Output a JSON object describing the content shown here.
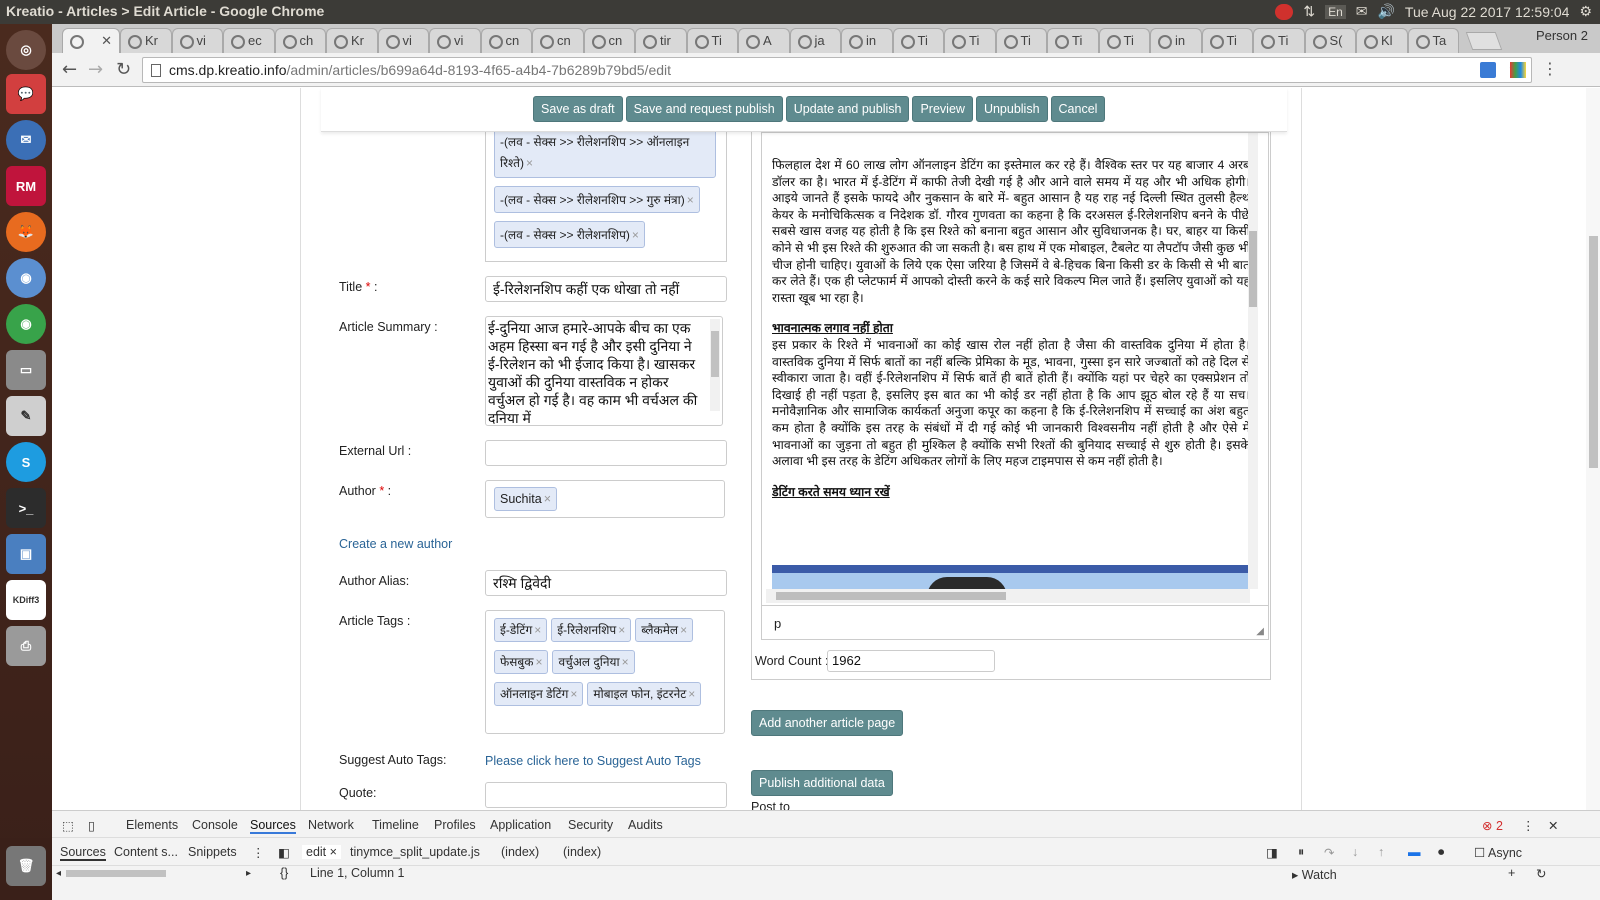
{
  "os": {
    "window_title": "Kreatio - Articles > Edit Article - Google Chrome",
    "language": "En",
    "clock": "Tue Aug 22 2017 12:59:04"
  },
  "launcher": {
    "items": [
      "ubuntu-logo-icon",
      "chat-icon",
      "thunderbird-icon",
      "rubymine-icon",
      "firefox-icon",
      "chromium-icon",
      "chrome-icon",
      "files-icon",
      "text-editor-icon",
      "skype-icon",
      "terminal-icon",
      "virtualbox-icon",
      "kdiff3-icon",
      "printer-icon",
      "trash-icon"
    ],
    "rubymine_label": "RM",
    "kdiff_label": "KDiff3"
  },
  "tabs": [
    {
      "label": "",
      "active": true
    },
    {
      "label": "Kr"
    },
    {
      "label": "vi"
    },
    {
      "label": "ec"
    },
    {
      "label": "ch"
    },
    {
      "label": "Kr"
    },
    {
      "label": "vi"
    },
    {
      "label": "vi"
    },
    {
      "label": "cn"
    },
    {
      "label": "cn"
    },
    {
      "label": "cn"
    },
    {
      "label": "tir"
    },
    {
      "label": "Ti"
    },
    {
      "label": "A"
    },
    {
      "label": "ja"
    },
    {
      "label": "in"
    },
    {
      "label": "Ti"
    },
    {
      "label": "Ti"
    },
    {
      "label": "Ti"
    },
    {
      "label": "Ti"
    },
    {
      "label": "Ti"
    },
    {
      "label": "in"
    },
    {
      "label": "Ti"
    },
    {
      "label": "Ti"
    },
    {
      "label": "S("
    },
    {
      "label": "Kl"
    },
    {
      "label": "Ta"
    }
  ],
  "profile": "Person 2",
  "url": {
    "domain": "cms.dp.kreatio.info",
    "path": "/admin/articles/b699a64d-8193-4f65-a4b4-7b6289b79bd5/edit"
  },
  "actions": [
    "Save as draft",
    "Save and request publish",
    "Update and publish",
    "Preview",
    "Unpublish",
    "Cancel"
  ],
  "sections_box": {
    "chips": [
      "-(लव - सेक्स >> रीलेशनशिप >> ऑनलाइन रिश्ते)",
      "-(लव - सेक्स >> रीलेशनशिप >> गुरु मंत्रा)",
      "-(लव - सेक्स >> रीलेशनशिप)"
    ]
  },
  "form": {
    "title_label": "Title",
    "title_value": "ई-रिलेशनशिप कहीं एक धोखा तो नहीं",
    "summary_label": "Article Summary :",
    "summary_value": "ई-दुनिया आज हमारे-आपके बीच का एक अहम हिस्सा बन गई है और इसी दुनिया ने ई-रिलेशन को भी ईजाद किया है। खासकर युवाओं की दुनिया वास्तविक न होकर वर्चुअल हो गई है। वह काम भी वर्चअल की दनिया में",
    "external_url_label": "External Url :",
    "external_url_value": "",
    "author_label": "Author",
    "author_chip": "Suchita",
    "create_author_link": "Create a new author",
    "author_alias_label": "Author Alias:",
    "author_alias_value": "रश्मि द्विवेदी",
    "tags_label": "Article Tags :",
    "tags": [
      "ई-डेटिंग",
      "ई-रिलेशनशिप",
      "ब्लैकमेल",
      "फेसबुक",
      "वर्चुअल दुनिया",
      "ऑनलाइन डेटिंग",
      "मोबाइल फोन, इंटरनेट"
    ],
    "suggest_label": "Suggest Auto Tags:",
    "suggest_link": "Please click here to Suggest Auto Tags",
    "quote_label": "Quote:",
    "quote_value": ""
  },
  "editor": {
    "para1": "फिलहाल देश में 60 लाख लोग ऑनलाइन डेटिंग का इस्तेमाल कर रहे हैं। वैश्विक स्तर पर यह बाजार 4 अरब डॉलर का है। भारत में ई-डेटिंग में काफी तेजी देखी गई है और आने वाले समय में यह और भी अधिक होगी। आइये जानते हैं इसके फायदे और नुकसान के बारे में- बहुत आसान है यह राह नई दिल्ली स्थित तुलसी हैल्थ केयर के मनोचिकित्सक व निदेशक डॉ. गौरव गुणवता का कहना है कि दरअसल ई-रिलेशनशिप बनने के पीछे सबसे खास वजह यह होती है कि इस रिश्ते को बनाना बहुत आसान और सुविधाजनक है। घर, बाहर या किसी कोने से भी इस रिश्ते की शुरुआत की जा सकती है। बस हाथ में एक मोबाइल, टैबलेट या लैपटॉप जैसी कुछ भी चीज होनी चाहिए। युवाओं के लिये एक ऐसा जरिया है जिसमें वे बे-हिचक बिना किसी डर के किसी से भी बात कर लेते हैं। एक ही प्लेटफार्म में आपको दोस्ती करने के कई सारे विकल्प मिल जाते हैं। इसलिए युवाओं को यह रास्ता खूब भा रहा है।",
    "heading2": "भावनात्मक लगाव नहीं होता",
    "para2": "इस प्रकार के रिश्ते में भावनाओं का कोई खास रोल नहीं होता है जैसा की वास्तविक दुनिया में होता है। वास्तविक दुनिया में सिर्फ बातों का नहीं बल्कि प्रेमिका के मूड, भावना, गुस्सा इन सारे जज्बातों को तहे दिल से स्वीकारा जाता है। वहीं ई-रिलेशनशिप में सिर्फ बातें ही बातें होती हैं। क्योंकि यहां पर चेहरे का एक्सप्रेशन तो दिखाई ही नहीं पड़ता है, इसलिए इस बात का भी कोई डर नहीं होता है कि आप झूठ बोल रहे हैं या सच। मनोवैज्ञानिक और सामाजिक कार्यकर्ता अनुजा कपूर का कहना है कि ई-रिलेशनशिप में सच्चाई का अंश बहुत कम होता है क्योंकि इस तरह के संबंधों में दी गई कोई भी जानकारी विश्वसनीय नहीं होती है और ऐसे में भावनाओं का जुड़ना तो बहुत ही मुश्किल है क्योंकि सभी रिश्तों की बुनियाद सच्चाई से शुरु होती है। इसके अलावा भी इस तरह के डेटिंग अधिकतर लोगों के लिए महज टाइमपास से कम नहीं होती है।",
    "heading3": "डेटिंग करते समय ध्यान रखें",
    "status_path": "p",
    "word_count_label": "Word Count :",
    "word_count": "1962"
  },
  "extra_buttons": {
    "add_page": "Add another article page",
    "publish_additional": "Publish additional data",
    "post_to": "Post to"
  },
  "devtools": {
    "tabs": [
      "Elements",
      "Console",
      "Sources",
      "Network",
      "Timeline",
      "Profiles",
      "Application",
      "Security",
      "Audits"
    ],
    "active_tab": "Sources",
    "error_count": "2",
    "nav_tabs": [
      "Sources",
      "Content s...",
      "Snippets"
    ],
    "file_tabs": [
      "edit",
      "tinymce_split_update.js",
      "(index)",
      "(index)"
    ],
    "cursor": "Line 1, Column 1",
    "async_label": "Async",
    "watch_label": "Watch"
  }
}
